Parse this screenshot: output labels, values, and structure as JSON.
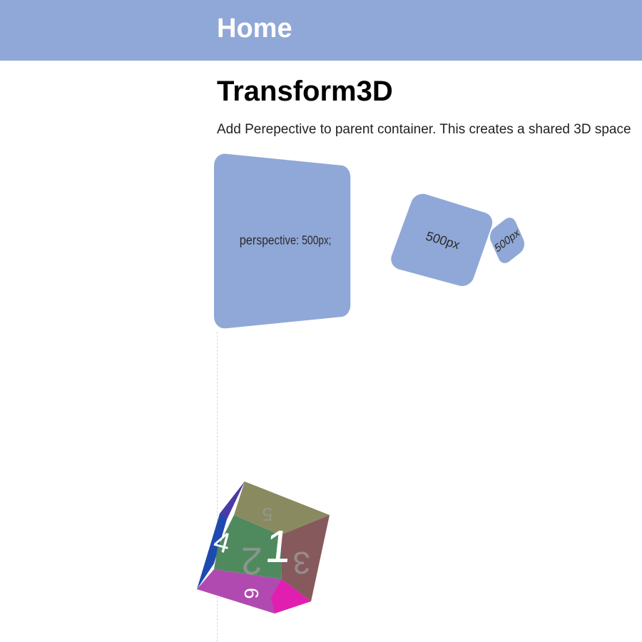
{
  "header": {
    "home_label": "Home"
  },
  "main": {
    "title": "Transform3D",
    "description": "Add Perepective to parent container. This creates a shared 3D space"
  },
  "cards": {
    "large_label": "perspective: 500px;",
    "medium_label": "500px",
    "small_label": "500px"
  },
  "cube": {
    "faces": [
      "1",
      "2",
      "3",
      "4",
      "5",
      "6"
    ],
    "colors": {
      "front": "#4f8a5e",
      "top": "#8a8a60",
      "right": "#865a5c",
      "left": "#1e4ab0",
      "bottom": "#b04ab0",
      "accent": "#e01fb0"
    }
  },
  "colors": {
    "header_bg": "#90a8d8",
    "card_bg": "#90a8d8"
  }
}
